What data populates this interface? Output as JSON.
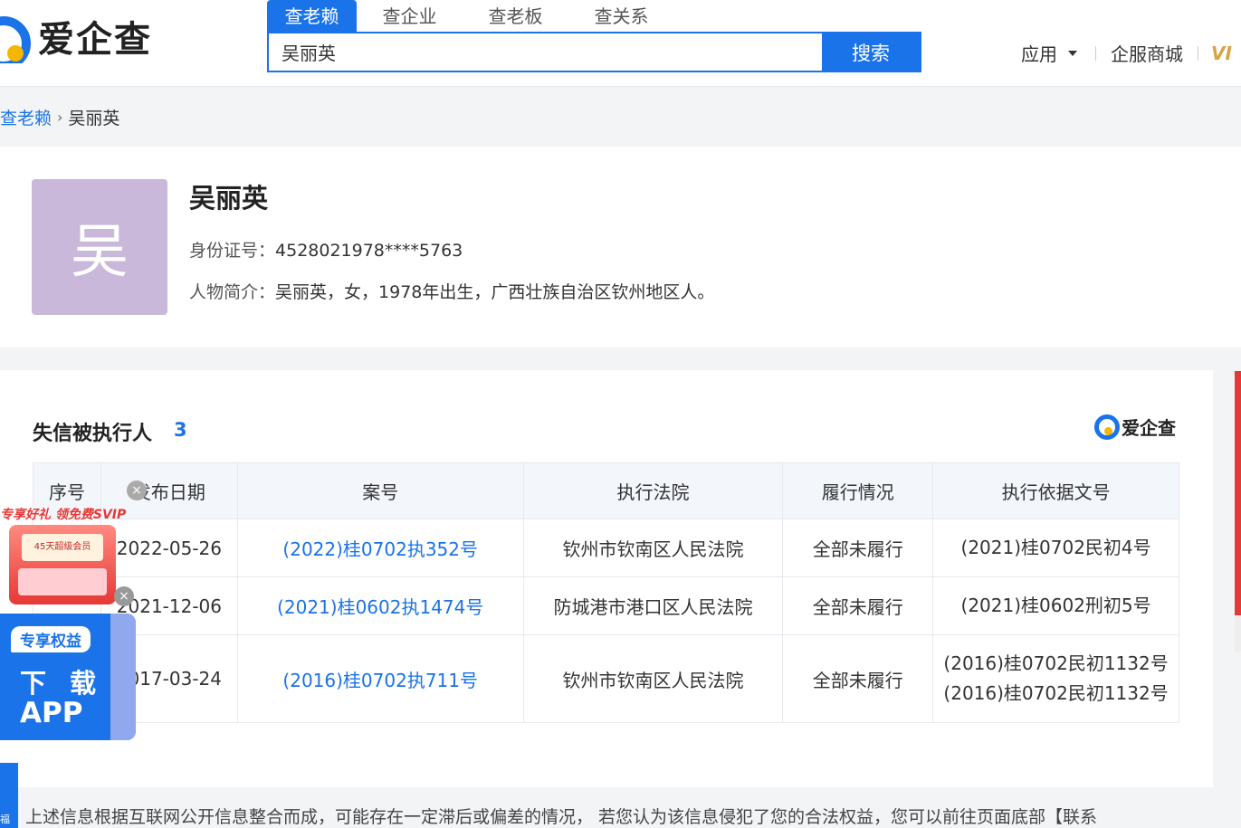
{
  "header": {
    "logo_text": "爱企查",
    "tabs": [
      {
        "label": "查老赖",
        "active": true
      },
      {
        "label": "查企业",
        "active": false
      },
      {
        "label": "查老板",
        "active": false
      },
      {
        "label": "查关系",
        "active": false
      }
    ],
    "search_value": "吴丽英",
    "search_button": "搜索",
    "nav": {
      "apps": "应用",
      "mall": "企服商城",
      "vip": "VI"
    }
  },
  "breadcrumb": {
    "root": "查老赖",
    "current": "吴丽英"
  },
  "profile": {
    "avatar_char": "吴",
    "name": "吴丽英",
    "id_label": "身份证号：",
    "id_value": "4528021978****5763",
    "bio_label": "人物简介：",
    "bio_value": "吴丽英，女，1978年出生，广西壮族自治区钦州地区人。"
  },
  "section": {
    "title": "失信被执行人",
    "count": "3",
    "brand": "爱企查",
    "columns": [
      "序号",
      "发布日期",
      "案号",
      "执行法院",
      "履行情况",
      "执行依据文号"
    ],
    "rows": [
      {
        "date": "2022-05-26",
        "case_no": "(2022)桂0702执352号",
        "court": "钦州市钦南区人民法院",
        "status": "全部未履行",
        "basis": [
          "(2021)桂0702民初4号"
        ]
      },
      {
        "date": "2021-12-06",
        "case_no": "(2021)桂0602执1474号",
        "court": "防城港市港口区人民法院",
        "status": "全部未履行",
        "basis": [
          "(2021)桂0602刑初5号"
        ]
      },
      {
        "date": "2017-03-24",
        "case_no": "(2016)桂0702执711号",
        "court": "钦州市钦南区人民法院",
        "status": "全部未履行",
        "basis": [
          "(2016)桂0702民初1132号",
          "(2016)桂0702民初1132号"
        ]
      }
    ]
  },
  "note": "上述信息根据互联网公开信息整合而成，可能存在一定滞后或偏差的情况， 若您认为该信息侵犯了您的合法权益，您可以前往页面底部【联系",
  "promo": {
    "banner": "专享好礼 领免费SVIP",
    "gift_line": "45天超级会员",
    "app_tag": "专享权益",
    "download": "下 载",
    "app": "APP",
    "side_tab": "福利"
  },
  "colors": {
    "accent": "#1a73e8",
    "avatar_bg": "#c9b8d9",
    "vip": "#d9a441",
    "promo_red": "#e53935"
  }
}
